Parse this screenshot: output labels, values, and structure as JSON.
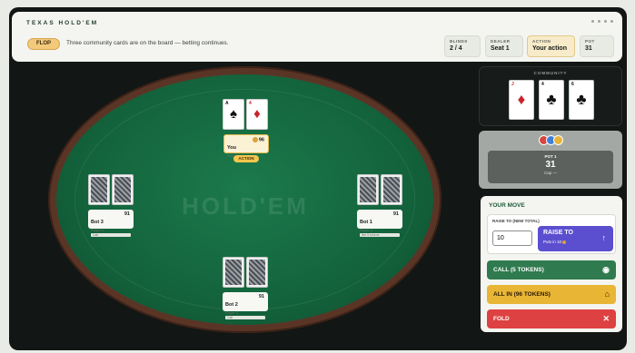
{
  "header": {
    "app_title": "TEXAS HOLD'EM",
    "phase": "FLOP",
    "message": "Three community cards are on the board — betting continues.",
    "stats": [
      {
        "key": "BLINDS",
        "value": "2 / 4"
      },
      {
        "key": "DEALER",
        "value": "Seat 1"
      },
      {
        "key": "ACTION",
        "value": "Your action"
      },
      {
        "key": "POT",
        "value": "31"
      }
    ]
  },
  "table": {
    "watermark": "HOLD'EM"
  },
  "players": {
    "you": {
      "name": "You",
      "sub": "Player 1",
      "chips": "96",
      "badge": "ACTION",
      "cards": [
        {
          "rank": "A",
          "suit": "♠",
          "color": "black"
        },
        {
          "rank": "4",
          "suit": "♦",
          "color": "red"
        }
      ]
    },
    "bot3": {
      "name": "Bot 3",
      "sub": "Player 4",
      "chips": "91",
      "status": "Call"
    },
    "bot1": {
      "name": "Bot 1",
      "sub": "Player 2",
      "chips": "91",
      "status": "Bet 5 tokens"
    },
    "bot2": {
      "name": "Bot 2",
      "sub": "Player 3",
      "chips": "91",
      "status": "Call"
    }
  },
  "community": {
    "label": "COMMUNITY",
    "cards": [
      {
        "rank": "J",
        "suit": "♦",
        "color": "red"
      },
      {
        "rank": "4",
        "suit": "♣",
        "color": "black"
      },
      {
        "rank": "6",
        "suit": "♣",
        "color": "black"
      }
    ]
  },
  "pot": {
    "label": "POT 1",
    "value": "31",
    "cap": "Cap —"
  },
  "move": {
    "title": "YOUR MOVE",
    "raise_label": "RAISE TO (NEW TOTAL)",
    "raise_value": "10",
    "raise_button": "RAISE TO",
    "raise_sub": "Puts in 10",
    "call": "CALL (5 TOKENS)",
    "allin": "ALL IN (96 TOKENS)",
    "fold": "FOLD"
  },
  "colors": {
    "felt": "#13633c",
    "rail": "#5a3526",
    "raise": "#5b4fd0",
    "call": "#2f7a4e",
    "allin": "#e9b535",
    "fold": "#de4141"
  }
}
